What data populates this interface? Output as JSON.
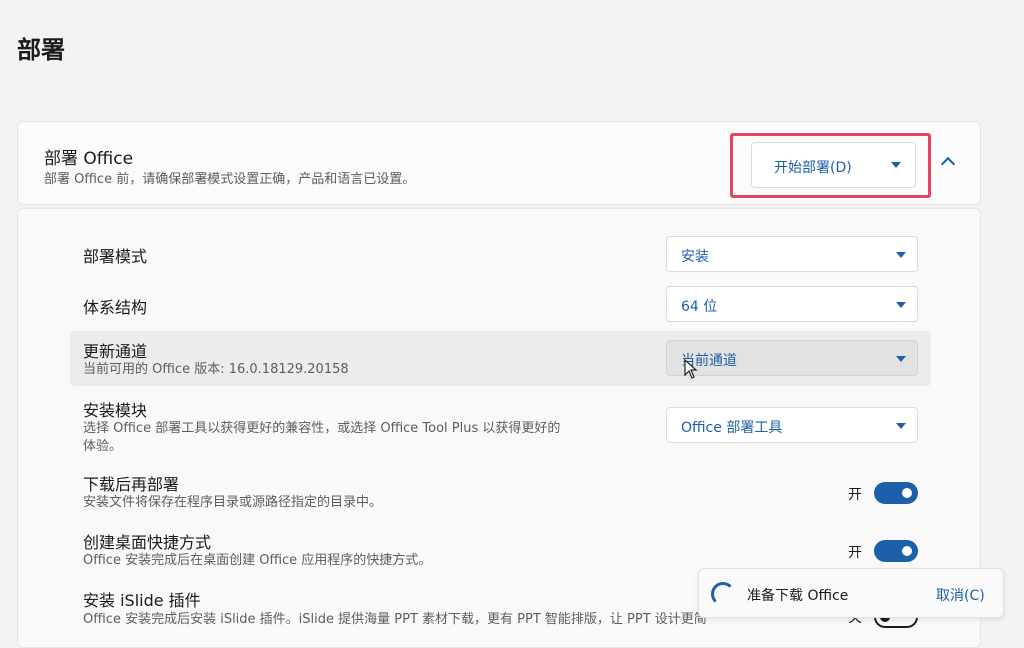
{
  "page_title": "部署",
  "header": {
    "title": "部署 Office",
    "description": "部署 Office 前，请确保部署模式设置正确，产品和语言已设置。",
    "deploy_button": "开始部署(D)",
    "collapse_icon": "chevron-up-icon"
  },
  "settings": {
    "deploy_mode": {
      "label": "部署模式",
      "value": "安装"
    },
    "architecture": {
      "label": "体系结构",
      "value": "64 位"
    },
    "update_channel": {
      "label": "更新通道",
      "description": "当前可用的 Office 版本: 16.0.18129.20158",
      "value": "当前通道"
    },
    "install_module": {
      "label": "安装模块",
      "description_line1": "选择 Office 部署工具以获得更好的兼容性，或选择 Office Tool Plus 以获得更好的",
      "description_line2": "体验。",
      "value": "Office 部署工具"
    },
    "download_first": {
      "label": "下载后再部署",
      "description": "安装文件将保存在程序目录或源路径指定的目录中。",
      "toggle_label": "开",
      "state": true
    },
    "desktop_shortcut": {
      "label": "创建桌面快捷方式",
      "description": "Office 安装完成后在桌面创建 Office 应用程序的快捷方式。",
      "toggle_label": "开",
      "state": true
    },
    "islide": {
      "label": "安装 iSlide 插件",
      "description": "Office 安装完成后安装 iSlide 插件。iSlide 提供海量 PPT 素材下载，更有 PPT 智能排版，让 PPT 设计更简",
      "toggle_label": "关",
      "state": false
    }
  },
  "notification": {
    "text": "准备下载 Office",
    "cancel": "取消(C)"
  },
  "colors": {
    "accent": "#1d5fa8",
    "highlight_border": "#e5455f"
  }
}
